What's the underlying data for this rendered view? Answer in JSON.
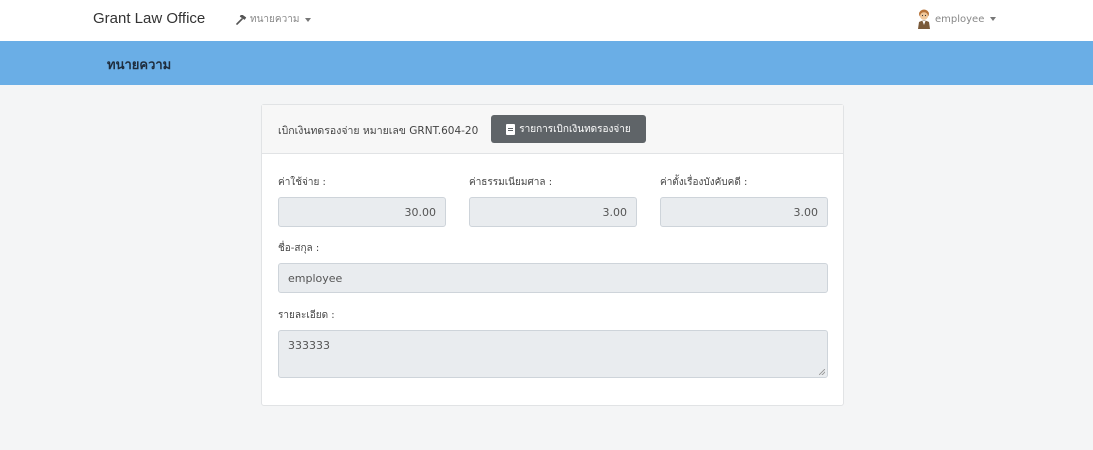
{
  "navbar": {
    "brand": "Grant Law Office",
    "menu_label": "ทนายความ",
    "user_label": "employee",
    "icons": {
      "menu": "gavel-icon",
      "user": "user-avatar-icon",
      "caret": "caret-down-icon"
    }
  },
  "hero": {
    "title": "ทนายความ"
  },
  "card": {
    "header_text": "เบิกเงินทดรองจ่าย หมายเลข GRNT.604-20",
    "list_button_label": "รายการเบิกเงินทดรองจ่าย",
    "fields": {
      "expense": {
        "label": "ค่าใช้จ่าย :",
        "value": "30.00"
      },
      "court_fee": {
        "label": "ค่าธรรมเนียมศาล :",
        "value": "3.00"
      },
      "enforcement_fee": {
        "label": "ค่าตั้งเรื่องบังคับคดี :",
        "value": "3.00"
      },
      "name": {
        "label": "ชื่อ-สกุล :",
        "value": "employee"
      },
      "details": {
        "label": "รายละเอียด :",
        "value": "333333"
      }
    }
  },
  "colors": {
    "hero_bg": "#6aaee6",
    "button_bg": "#5f6468",
    "field_bg": "#e9ecef",
    "page_bg": "#f4f5f6"
  }
}
